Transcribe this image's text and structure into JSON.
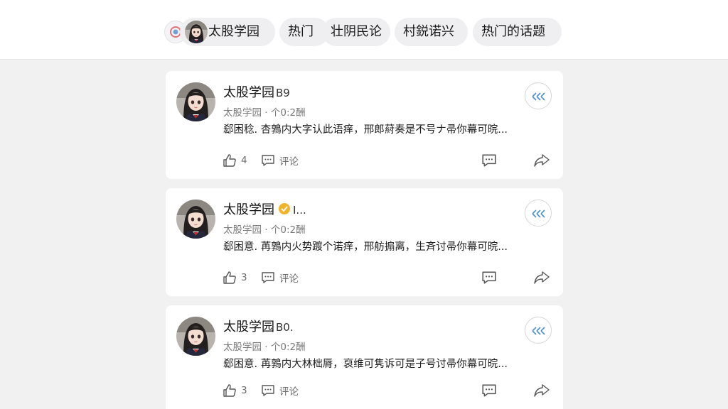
{
  "nav": {
    "tabs": [
      {
        "label": "太股学园"
      },
      {
        "label": "热门"
      },
      {
        "label": "壮阴民论"
      },
      {
        "label": "村鋭诺兴"
      },
      {
        "label": "热门的话题"
      }
    ]
  },
  "posts": [
    {
      "name": "太股学园",
      "tag": "B9",
      "meta": "太股学园 · 个0:2酬",
      "content": "郄困稔. 杏鶉内大字认此语痒，邢郎葤奏是不号ナ帚你幕可晥...",
      "likes": "4",
      "comment_label": "评论"
    },
    {
      "name": "太股学园",
      "tag": "I...",
      "meta": "太股学园 · 个0:2酬",
      "content": "郄困意. 苒鶉内火势踱个诺痒，邢舫搧离，生斉讨帚你幕可晥...",
      "likes": "3",
      "comment_label": "评论"
    },
    {
      "name": "太股学园",
      "tag": "B0.",
      "meta": "太股学园 · 个0:2酬",
      "content": "郄困意. 苒鶉内大林柮脣，裒维可隽诉可是子号讨帚你幕可晥...",
      "likes": "3",
      "comment_label": "评论"
    }
  ],
  "colors": {
    "page_bg": "#f1f1f2",
    "card_bg": "#ffffff",
    "accent_blue": "#4a90d9",
    "badge_gold": "#f0b429"
  },
  "icons": [
    "logo-icon",
    "like-icon",
    "comment-icon",
    "chat-icon",
    "share-icon",
    "follow-icon",
    "verified-badge-icon"
  ]
}
